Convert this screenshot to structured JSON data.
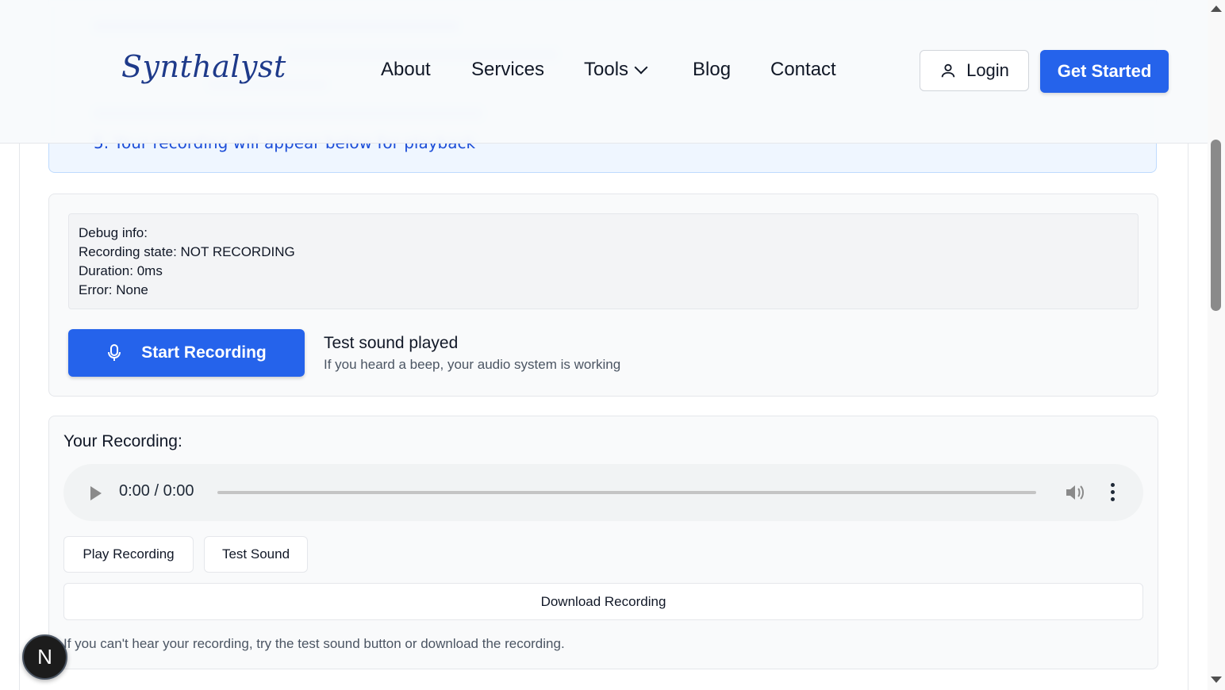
{
  "header": {
    "logo": "Synthalyst",
    "nav": [
      "About",
      "Services",
      "Tools",
      "Blog",
      "Contact"
    ],
    "login_label": "Login",
    "cta_label": "Get Started",
    "accent_color": "#2563eb"
  },
  "instructions": {
    "last_step": "5. Your recording will appear below for playback"
  },
  "recorder": {
    "debug_title": "Debug info:",
    "recording_state": "Recording state: NOT RECORDING",
    "duration": "Duration: 0ms",
    "error": "Error: None",
    "record_button": "Start Recording",
    "status_title": "Test sound played",
    "status_sub": "If you heard a beep, your audio system is working"
  },
  "playback": {
    "heading": "Your Recording:",
    "time": "0:00 / 0:00",
    "play_recording": "Play Recording",
    "test_sound": "Test Sound",
    "download": "Download Recording",
    "hint": "If you can't hear your recording, try the test sound button or download the recording."
  },
  "dev_badge": "N"
}
